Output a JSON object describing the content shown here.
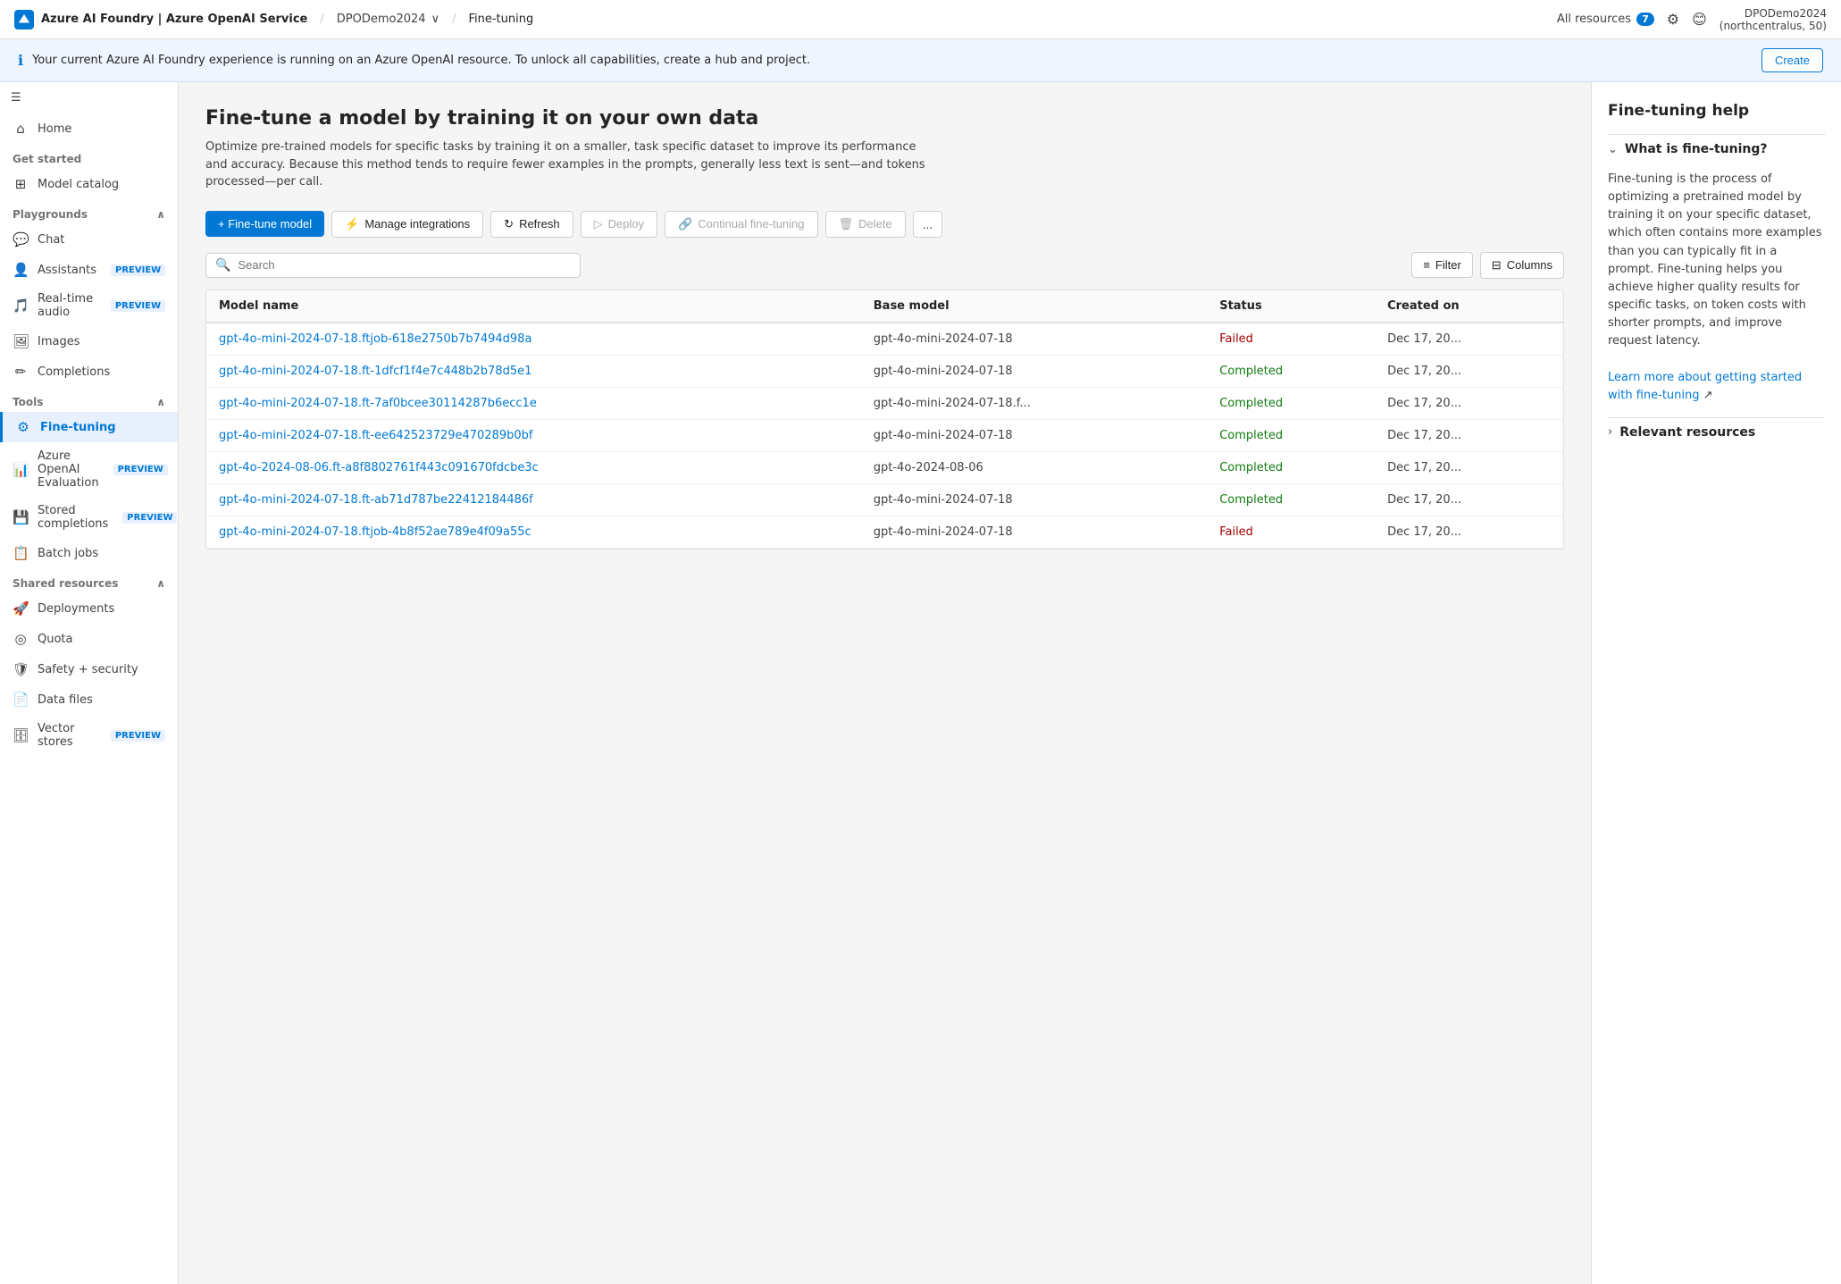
{
  "topbar": {
    "logo_text": "Azure AI Foundry | Azure OpenAI Service",
    "breadcrumb_workspace": "DPODemo2024",
    "breadcrumb_page": "Fine-tuning",
    "all_resources_label": "All resources",
    "all_resources_badge": "7",
    "user_name": "DPODemo2024",
    "user_region": "(northcentralus, 50)"
  },
  "info_banner": {
    "text": "Your current Azure AI Foundry experience is running on an Azure OpenAI resource. To unlock all capabilities, create a hub and project.",
    "create_label": "Create"
  },
  "sidebar": {
    "home_label": "Home",
    "get_started_label": "Get started",
    "model_catalog_label": "Model catalog",
    "playgrounds_label": "Playgrounds",
    "playgrounds_section": "Playgrounds",
    "chat_label": "Chat",
    "assistants_label": "Assistants",
    "assistants_preview": "PREVIEW",
    "realtime_audio_label": "Real-time audio",
    "realtime_audio_preview": "PREVIEW",
    "images_label": "Images",
    "completions_label": "Completions",
    "tools_label": "Tools",
    "fine_tuning_label": "Fine-tuning",
    "azure_openai_eval_label": "Azure OpenAI Evaluation",
    "azure_openai_eval_preview": "PREVIEW",
    "stored_completions_label": "Stored completions",
    "stored_completions_preview": "PREVIEW",
    "batch_jobs_label": "Batch jobs",
    "shared_resources_label": "Shared resources",
    "deployments_label": "Deployments",
    "quota_label": "Quota",
    "safety_security_label": "Safety + security",
    "data_files_label": "Data files",
    "vector_stores_label": "Vector stores",
    "vector_stores_preview": "PREVIEW"
  },
  "toolbar": {
    "fine_tune_model_label": "+ Fine-tune model",
    "manage_integrations_label": "Manage integrations",
    "refresh_label": "Refresh",
    "deploy_label": "Deploy",
    "continual_fine_tuning_label": "Continual fine-tuning",
    "delete_label": "Delete",
    "more_label": "..."
  },
  "search_filter": {
    "search_placeholder": "Search",
    "filter_label": "Filter",
    "columns_label": "Columns"
  },
  "table": {
    "col_model_name": "Model name",
    "col_base_model": "Base model",
    "col_status": "Status",
    "col_created_on": "Created on",
    "rows": [
      {
        "model_name": "gpt-4o-mini-2024-07-18.ftjob-618e2750b7b7494d98a",
        "base_model": "gpt-4o-mini-2024-07-18",
        "status": "Failed",
        "status_type": "failed",
        "created_on": "Dec 17, 20..."
      },
      {
        "model_name": "gpt-4o-mini-2024-07-18.ft-1dfcf1f4e7c448b2b78d5e1",
        "base_model": "gpt-4o-mini-2024-07-18",
        "status": "Completed",
        "status_type": "completed",
        "created_on": "Dec 17, 20..."
      },
      {
        "model_name": "gpt-4o-mini-2024-07-18.ft-7af0bcee30114287b6ecc1e",
        "base_model": "gpt-4o-mini-2024-07-18.f...",
        "status": "Completed",
        "status_type": "completed",
        "created_on": "Dec 17, 20..."
      },
      {
        "model_name": "gpt-4o-mini-2024-07-18.ft-ee642523729e470289b0bf",
        "base_model": "gpt-4o-mini-2024-07-18",
        "status": "Completed",
        "status_type": "completed",
        "created_on": "Dec 17, 20..."
      },
      {
        "model_name": "gpt-4o-2024-08-06.ft-a8f8802761f443c091670fdcbe3c",
        "base_model": "gpt-4o-2024-08-06",
        "status": "Completed",
        "status_type": "completed",
        "created_on": "Dec 17, 20..."
      },
      {
        "model_name": "gpt-4o-mini-2024-07-18.ft-ab71d787be22412184486f",
        "base_model": "gpt-4o-mini-2024-07-18",
        "status": "Completed",
        "status_type": "completed",
        "created_on": "Dec 17, 20..."
      },
      {
        "model_name": "gpt-4o-mini-2024-07-18.ftjob-4b8f52ae789e4f09a55c",
        "base_model": "gpt-4o-mini-2024-07-18",
        "status": "Failed",
        "status_type": "failed",
        "created_on": "Dec 17, 20..."
      }
    ]
  },
  "page": {
    "title": "Fine-tune a model by training it on your own data",
    "description": "Optimize pre-trained models for specific tasks by training it on a smaller, task specific dataset to improve its performance and accuracy. Because this method tends to require fewer examples in the prompts, generally less text is sent—and tokens processed—per call."
  },
  "help_panel": {
    "title": "Fine-tuning help",
    "section1_title": "What is fine-tuning?",
    "section1_body": "Fine-tuning is the process of optimizing a pretrained model by training it on your specific dataset, which often contains more examples than you can typically fit in a prompt. Fine-tuning helps you achieve higher quality results for specific tasks, on token costs with shorter prompts, and improve request latency.",
    "link1_text": "Learn more about getting started with fine-tuning",
    "section2_title": "Relevant resources"
  }
}
